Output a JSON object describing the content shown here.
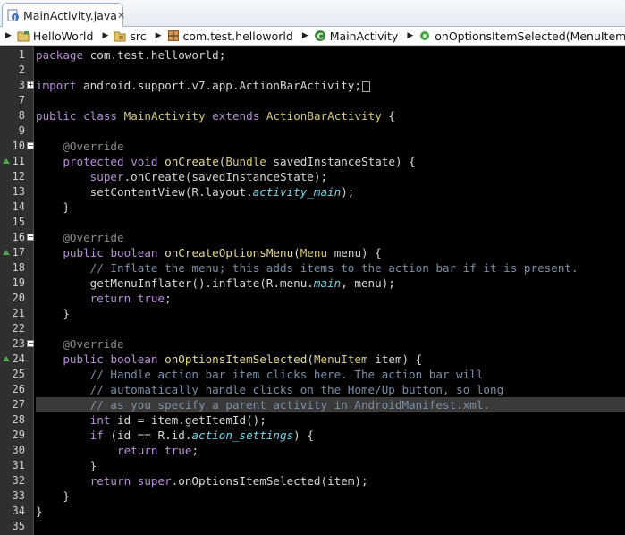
{
  "tab": {
    "label": "MainActivity.java",
    "close": "✕"
  },
  "breadcrumb": [
    {
      "label": "HelloWorld",
      "icon": "project-icon"
    },
    {
      "label": "src",
      "icon": "package-folder-icon"
    },
    {
      "label": "com.test.helloworld",
      "icon": "package-icon"
    },
    {
      "label": "MainActivity",
      "icon": "class-icon"
    },
    {
      "label": "onOptionsItemSelected(MenuItem) : boolean",
      "icon": "method-icon"
    }
  ],
  "colors": {
    "keyword": "#b98fd8",
    "comment": "#7a8fa8",
    "field": "#73d6e8",
    "class": "#d8c878"
  },
  "lines": [
    {
      "num": "1",
      "tokens": [
        [
          "kw",
          "package"
        ],
        [
          "plain",
          " com.test.helloworld;"
        ]
      ]
    },
    {
      "num": "2",
      "tokens": []
    },
    {
      "num": "3",
      "fold": "+",
      "tokens": [
        [
          "kw",
          "import"
        ],
        [
          "plain",
          " android.support.v7.app.ActionBarActivity;"
        ]
      ],
      "foldbox": true
    },
    {
      "num": "7",
      "tokens": []
    },
    {
      "num": "8",
      "tokens": [
        [
          "kw",
          "public"
        ],
        [
          "plain",
          " "
        ],
        [
          "kw",
          "class"
        ],
        [
          "plain",
          " "
        ],
        [
          "cls",
          "MainActivity"
        ],
        [
          "plain",
          " "
        ],
        [
          "kw",
          "extends"
        ],
        [
          "plain",
          " "
        ],
        [
          "cls",
          "ActionBarActivity"
        ],
        [
          "plain",
          " {"
        ]
      ]
    },
    {
      "num": "9",
      "tokens": []
    },
    {
      "num": "10",
      "fold": "−",
      "tokens": [
        [
          "plain",
          "    "
        ],
        [
          "ann",
          "@Override"
        ]
      ]
    },
    {
      "num": "11",
      "override": true,
      "tokens": [
        [
          "plain",
          "    "
        ],
        [
          "kw",
          "protected"
        ],
        [
          "plain",
          " "
        ],
        [
          "kw",
          "void"
        ],
        [
          "plain",
          " "
        ],
        [
          "meth",
          "onCreate"
        ],
        [
          "plain",
          "("
        ],
        [
          "cls",
          "Bundle"
        ],
        [
          "plain",
          " savedInstanceState) {"
        ]
      ]
    },
    {
      "num": "12",
      "tokens": [
        [
          "plain",
          "        "
        ],
        [
          "kw",
          "super"
        ],
        [
          "plain",
          ".onCreate(savedInstanceState);"
        ]
      ]
    },
    {
      "num": "13",
      "tokens": [
        [
          "plain",
          "        setContentView(R.layout."
        ],
        [
          "fld",
          "activity_main"
        ],
        [
          "plain",
          ");"
        ]
      ]
    },
    {
      "num": "14",
      "tokens": [
        [
          "plain",
          "    }"
        ]
      ]
    },
    {
      "num": "15",
      "tokens": []
    },
    {
      "num": "16",
      "fold": "−",
      "tokens": [
        [
          "plain",
          "    "
        ],
        [
          "ann",
          "@Override"
        ]
      ]
    },
    {
      "num": "17",
      "override": true,
      "tokens": [
        [
          "plain",
          "    "
        ],
        [
          "kw",
          "public"
        ],
        [
          "plain",
          " "
        ],
        [
          "kw",
          "boolean"
        ],
        [
          "plain",
          " "
        ],
        [
          "meth",
          "onCreateOptionsMenu"
        ],
        [
          "plain",
          "("
        ],
        [
          "cls",
          "Menu"
        ],
        [
          "plain",
          " menu) {"
        ]
      ]
    },
    {
      "num": "18",
      "tokens": [
        [
          "plain",
          "        "
        ],
        [
          "cmt",
          "// Inflate the menu; this adds items to the action bar if it is present."
        ]
      ]
    },
    {
      "num": "19",
      "tokens": [
        [
          "plain",
          "        getMenuInflater().inflate(R.menu."
        ],
        [
          "fld",
          "main"
        ],
        [
          "plain",
          ", menu);"
        ]
      ]
    },
    {
      "num": "20",
      "tokens": [
        [
          "plain",
          "        "
        ],
        [
          "kw",
          "return"
        ],
        [
          "plain",
          " "
        ],
        [
          "kw",
          "true"
        ],
        [
          "plain",
          ";"
        ]
      ]
    },
    {
      "num": "21",
      "tokens": [
        [
          "plain",
          "    }"
        ]
      ]
    },
    {
      "num": "22",
      "tokens": []
    },
    {
      "num": "23",
      "fold": "−",
      "tokens": [
        [
          "plain",
          "    "
        ],
        [
          "ann",
          "@Override"
        ]
      ]
    },
    {
      "num": "24",
      "override": true,
      "tokens": [
        [
          "plain",
          "    "
        ],
        [
          "kw",
          "public"
        ],
        [
          "plain",
          " "
        ],
        [
          "kw",
          "boolean"
        ],
        [
          "plain",
          " "
        ],
        [
          "meth",
          "onOptionsItemSelected"
        ],
        [
          "plain",
          "("
        ],
        [
          "cls",
          "MenuItem"
        ],
        [
          "plain",
          " item) {"
        ]
      ]
    },
    {
      "num": "25",
      "tokens": [
        [
          "plain",
          "        "
        ],
        [
          "cmt",
          "// Handle action bar item clicks here. The action bar will"
        ]
      ]
    },
    {
      "num": "26",
      "tokens": [
        [
          "plain",
          "        "
        ],
        [
          "cmt",
          "// automatically handle clicks on the Home/Up button, so long"
        ]
      ]
    },
    {
      "num": "27",
      "current": true,
      "tokens": [
        [
          "plain",
          "        "
        ],
        [
          "cmt",
          "// as you specify a parent activity in AndroidManifest.xml."
        ]
      ]
    },
    {
      "num": "28",
      "tokens": [
        [
          "plain",
          "        "
        ],
        [
          "kw",
          "int"
        ],
        [
          "plain",
          " id = item.getItemId();"
        ]
      ]
    },
    {
      "num": "29",
      "tokens": [
        [
          "plain",
          "        "
        ],
        [
          "kw",
          "if"
        ],
        [
          "plain",
          " (id == R.id."
        ],
        [
          "fld",
          "action_settings"
        ],
        [
          "plain",
          ") {"
        ]
      ]
    },
    {
      "num": "30",
      "tokens": [
        [
          "plain",
          "            "
        ],
        [
          "kw",
          "return"
        ],
        [
          "plain",
          " "
        ],
        [
          "kw",
          "true"
        ],
        [
          "plain",
          ";"
        ]
      ]
    },
    {
      "num": "31",
      "tokens": [
        [
          "plain",
          "        }"
        ]
      ]
    },
    {
      "num": "32",
      "tokens": [
        [
          "plain",
          "        "
        ],
        [
          "kw",
          "return"
        ],
        [
          "plain",
          " "
        ],
        [
          "kw",
          "super"
        ],
        [
          "plain",
          ".onOptionsItemSelected(item);"
        ]
      ]
    },
    {
      "num": "33",
      "tokens": [
        [
          "plain",
          "    }"
        ]
      ]
    },
    {
      "num": "34",
      "tokens": [
        [
          "plain",
          "}"
        ]
      ]
    },
    {
      "num": "35",
      "tokens": []
    }
  ]
}
